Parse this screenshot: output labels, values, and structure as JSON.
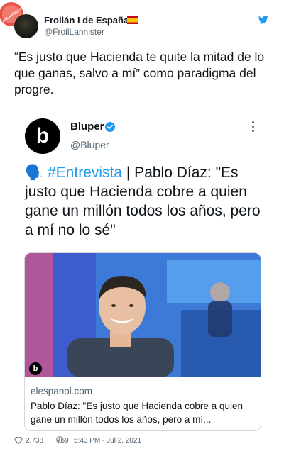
{
  "watermark": {
    "text": "VISTOENLASREDES.COM"
  },
  "header": {
    "display_name": "Froilán I de España",
    "handle": "@FroilLannister",
    "flag_icon": "spain-flag-icon",
    "bird_icon": "twitter-bird-icon"
  },
  "tweet": {
    "text": "“Es justo que Hacienda te quite la mitad de lo que ganas, salvo a mí” como paradigma del progre."
  },
  "quote": {
    "avatar_letter": "b",
    "name": "Bluper",
    "handle": "@Bluper",
    "emoji": "🗣️",
    "hashtag": "#Entrevista",
    "text": " | Pablo Díaz: \"Es justo que Hacienda cobre a quien gane un millón todos los años, pero a mí no lo sé\""
  },
  "card": {
    "logo_letter": "b",
    "domain": "elespanol.com",
    "title": "Pablo Díaz: \"Es justo que Hacienda cobre a quien gane un millón todos los años, pero a mí..."
  },
  "footer": {
    "likes": "2,738",
    "info_number": "769",
    "timestamp": "5:43 PM - Jul 2, 2021"
  },
  "colors": {
    "accent": "#1d9bf0",
    "text": "#0f1419",
    "muted": "#536471"
  }
}
